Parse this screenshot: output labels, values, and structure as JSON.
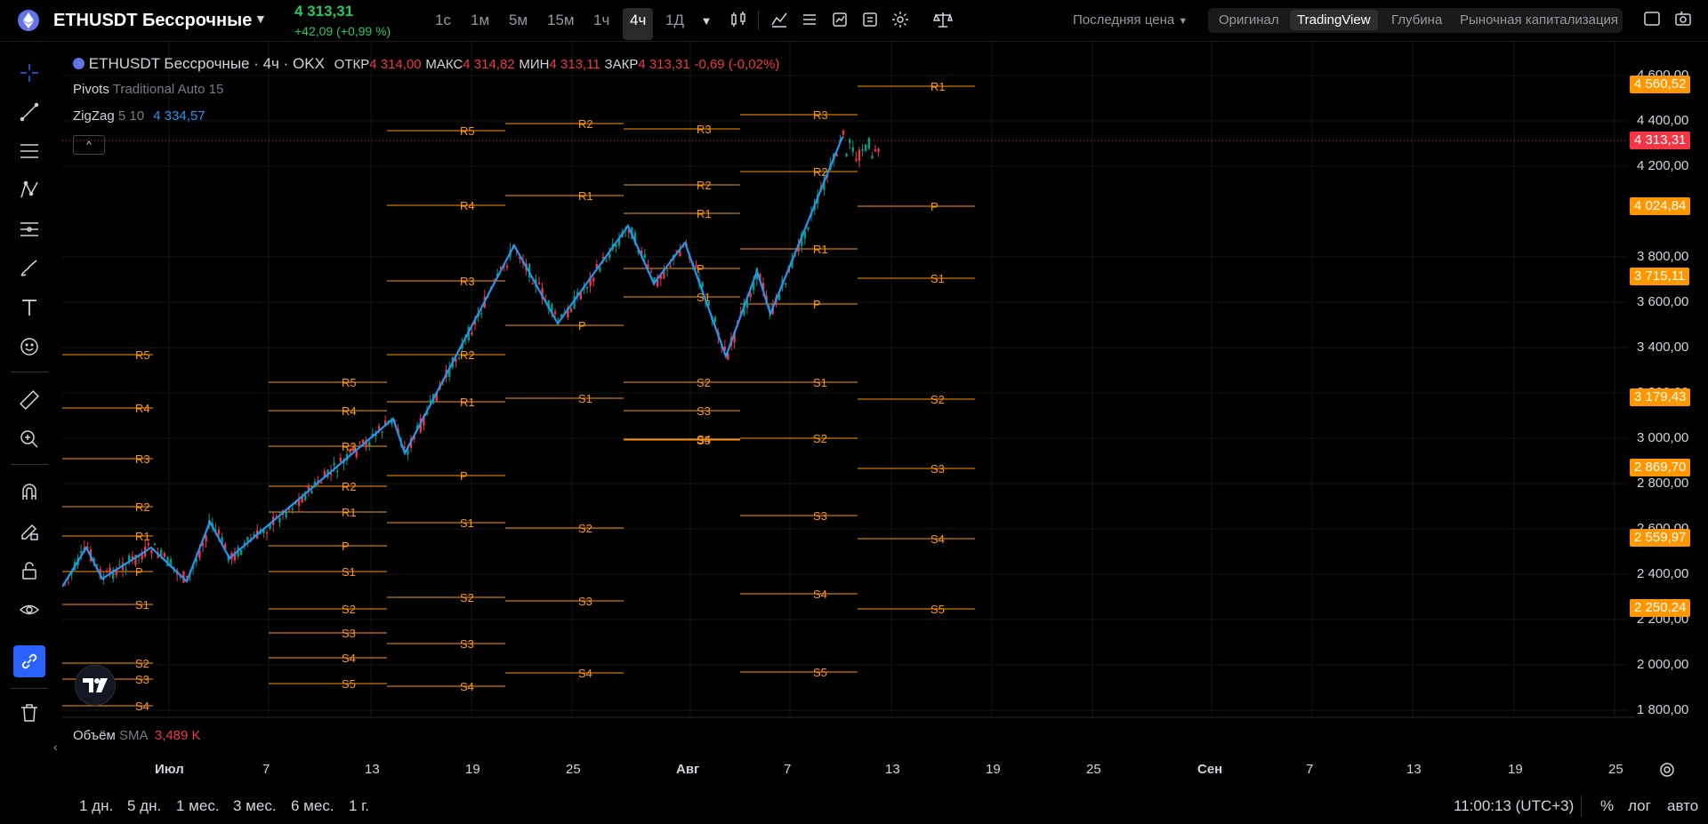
{
  "header": {
    "symbol": "ETHUSDT Бессрочные",
    "last_price": "4 313,31",
    "change": "+42,09 (+0,99 %)",
    "timeframes": [
      "1с",
      "1м",
      "5м",
      "15м",
      "1ч",
      "4ч",
      "1Д"
    ],
    "active_timeframe": "4ч",
    "price_type": "Последняя цена",
    "view_modes": [
      "Оригинал",
      "TradingView",
      "Глубина",
      "Рыночная капитализация"
    ],
    "active_view_mode": "TradingView"
  },
  "legend": {
    "title": "ETHUSDT Бессрочные · 4ч · OKX",
    "open_label": "ОТКР",
    "open": "4 314,00",
    "high_label": "МАКС",
    "high": "4 314,82",
    "low_label": "МИН",
    "low": "4 313,11",
    "close_label": "ЗАКР",
    "close": "4 313,31",
    "change": "-0,69 (-0,02%)"
  },
  "indicators": {
    "pivots": {
      "name": "Pivots",
      "params": "Traditional Auto 15"
    },
    "zigzag": {
      "name": "ZigZag",
      "params": "5 10",
      "value": "4 334,57"
    },
    "volume": {
      "name": "Объём",
      "ma": "SMA",
      "value": "3,489 K"
    }
  },
  "price_axis": [
    "4 600,00",
    "4 400,00",
    "4 200,00",
    "3 800,00",
    "3 600,00",
    "3 400,00",
    "3 200,00",
    "3 000,00",
    "2 800,00",
    "2 600,00",
    "2 400,00",
    "2 200,00",
    "2 000,00",
    "1 800,00"
  ],
  "price_tags": [
    {
      "value": "4 560,52",
      "color": "#ff9800"
    },
    {
      "value": "4 313,31",
      "color": "#f23645"
    },
    {
      "value": "4 024,84",
      "color": "#ff9800"
    },
    {
      "value": "3 715,11",
      "color": "#ff9800"
    },
    {
      "value": "3 179,43",
      "color": "#ff9800"
    },
    {
      "value": "2 869,70",
      "color": "#ff9800"
    },
    {
      "value": "2 559,97",
      "color": "#ff9800"
    },
    {
      "value": "2 250,24",
      "color": "#ff9800"
    }
  ],
  "time_axis": [
    "Июл",
    "7",
    "13",
    "19",
    "25",
    "Авг",
    "7",
    "13",
    "19",
    "25",
    "Сен",
    "7",
    "13",
    "19",
    "25"
  ],
  "bottom": {
    "ranges": [
      "1 дн.",
      "5 дн.",
      "1 мес.",
      "3 мес.",
      "6 мес.",
      "1 г."
    ],
    "clock": "11:00:13 (UTC+3)",
    "opt_percent": "%",
    "opt_log": "лог",
    "opt_auto": "авто"
  },
  "pivot_labels": [
    "R5",
    "R4",
    "R3",
    "R2",
    "R1",
    "P",
    "S1",
    "S2",
    "S3",
    "S4",
    "S5"
  ],
  "colors": {
    "background": "#000000",
    "pivot": "#ff9800",
    "zigzag": "#2196f3",
    "up": "#089981",
    "down": "#f23645",
    "accent": "#2962ff"
  }
}
